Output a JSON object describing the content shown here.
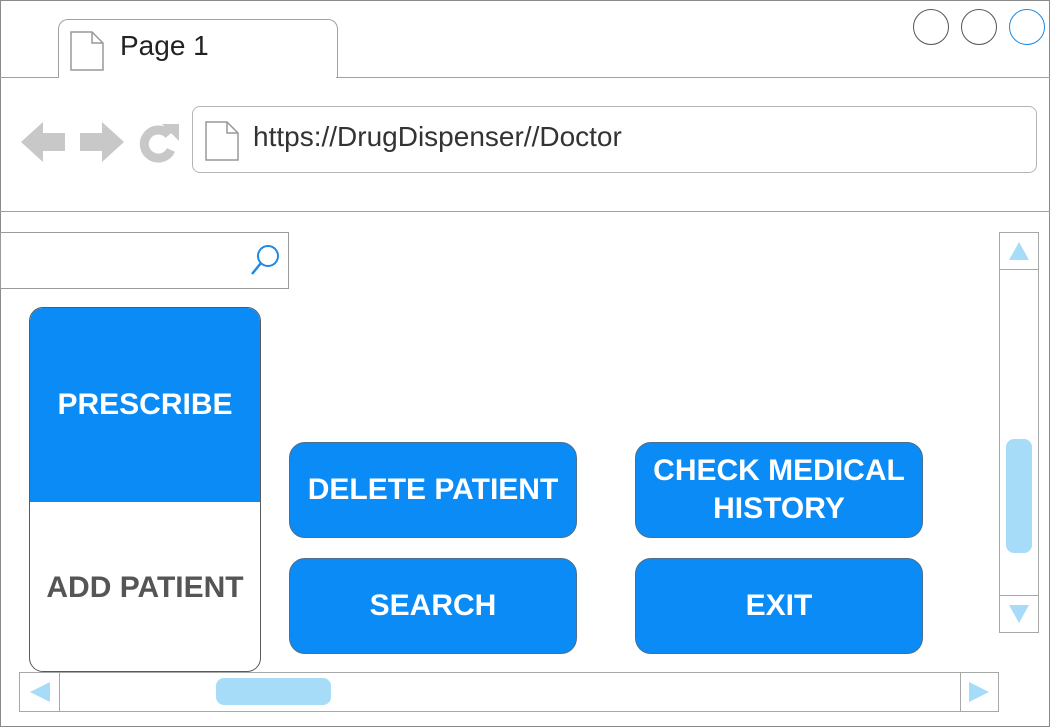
{
  "browser": {
    "tab_title": "Page 1",
    "url": "https://DrugDispenser//Doctor"
  },
  "search": {
    "placeholder": ""
  },
  "side_tabs": [
    {
      "label": "PRESCRIBE",
      "active": true
    },
    {
      "label": "ADD PATIENT",
      "active": false
    }
  ],
  "actions": {
    "delete_patient": "DELETE PATIENT",
    "check_history_line1": "CHECK MEDICAL",
    "check_history_line2": "HISTORY",
    "search": "SEARCH",
    "exit": "EXIT"
  },
  "colors": {
    "accent": "#0a8bf5",
    "scroll_thumb": "#a6dcf7",
    "arrow_gray": "#c8c8c8"
  },
  "icons": {
    "back": "arrow-left-icon",
    "forward": "arrow-right-icon",
    "reload": "reload-icon",
    "page": "page-icon",
    "search": "magnifier-icon"
  }
}
